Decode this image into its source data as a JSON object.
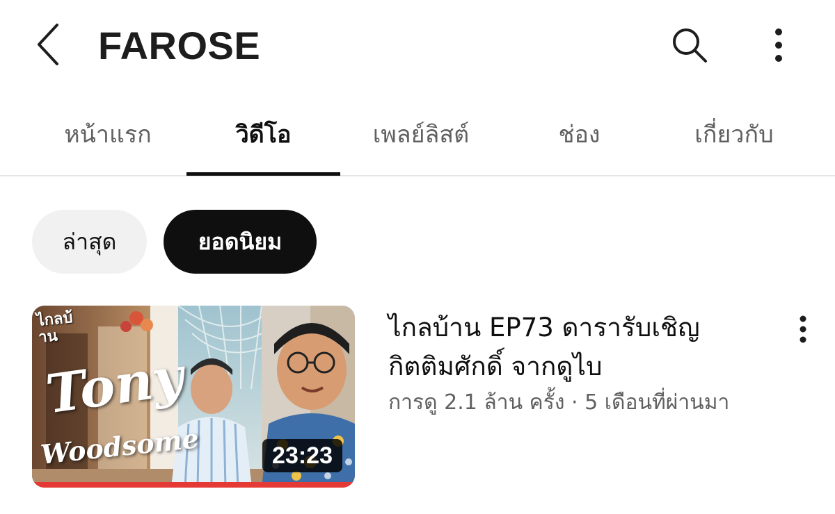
{
  "header": {
    "back_icon": "chevron-left-icon",
    "title": "FAROSE",
    "search_icon": "search-icon",
    "more_icon": "more-vert-icon"
  },
  "tabs": [
    {
      "label": "หน้าแรก",
      "active": false
    },
    {
      "label": "วิดีโอ",
      "active": true
    },
    {
      "label": "เพลย์ลิสต์",
      "active": false
    },
    {
      "label": "ช่อง",
      "active": false
    },
    {
      "label": "เกี่ยวกับ",
      "active": false
    }
  ],
  "filters": {
    "latest": {
      "label": "ล่าสุด",
      "selected": false
    },
    "popular": {
      "label": "ยอดนิยม",
      "selected": true
    }
  },
  "videos": [
    {
      "title": "ไกลบ้าน EP73 ดารารับเชิญ กิตติมศักดิ์ จากดูไบ",
      "meta": "การดู 2.1 ล้าน ครั้ง · 5 เดือนที่ผ่านมา",
      "duration": "23:23",
      "thumbnail_text": {
        "badge": "ไกลบ้าน",
        "name_line1": "Tony",
        "name_line2": "Woodsome"
      },
      "watch_progress": 1.0,
      "more_icon": "more-vert-icon"
    }
  ],
  "colors": {
    "active_tab": "#0f0f0f",
    "inactive_tab": "#606060",
    "chip_selected_bg": "#0f0f0f",
    "chip_bg": "#f1f1f1",
    "progress": "#e53935"
  }
}
